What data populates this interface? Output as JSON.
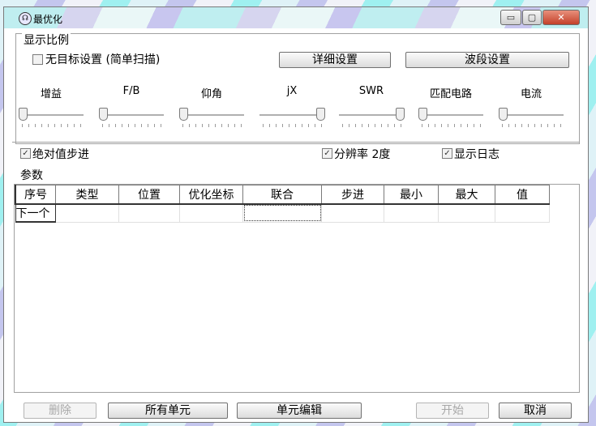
{
  "window": {
    "title": "最优化",
    "min_glyph": "▭",
    "max_glyph": "▢",
    "close_glyph": "✕"
  },
  "scale_group": {
    "label": "显示比例",
    "no_target": {
      "label": "无目标设置 (简单扫描)",
      "checked": false
    },
    "detail_button": "详细设置",
    "band_button": "波段设置",
    "sliders": [
      {
        "label": "增益",
        "level": 0.0
      },
      {
        "label": "F/B",
        "level": 0.0
      },
      {
        "label": "仰角",
        "level": 0.0
      },
      {
        "label": "jX",
        "level": 1.0
      },
      {
        "label": "SWR",
        "level": 1.0
      },
      {
        "label": "匹配电路",
        "level": 0.0
      },
      {
        "label": "电流",
        "level": 0.0
      }
    ]
  },
  "options": {
    "absolute_step": {
      "label": "绝对值步进",
      "checked": true
    },
    "resolution": {
      "label": "分辨率 2度",
      "checked": true
    },
    "show_log": {
      "label": "显示日志",
      "checked": true
    }
  },
  "params": {
    "label": "参数",
    "columns": [
      "序号",
      "类型",
      "位置",
      "优化坐标",
      "联合",
      "步进",
      "最小",
      "最大",
      "值"
    ],
    "row": [
      "下一个",
      "",
      "",
      "",
      "",
      "",
      "",
      "",
      ""
    ]
  },
  "footer": {
    "delete": "删除",
    "all_units": "所有单元",
    "edit_unit": "单元编辑",
    "start": "开始",
    "cancel": "取消"
  },
  "check_glyph": "✓"
}
